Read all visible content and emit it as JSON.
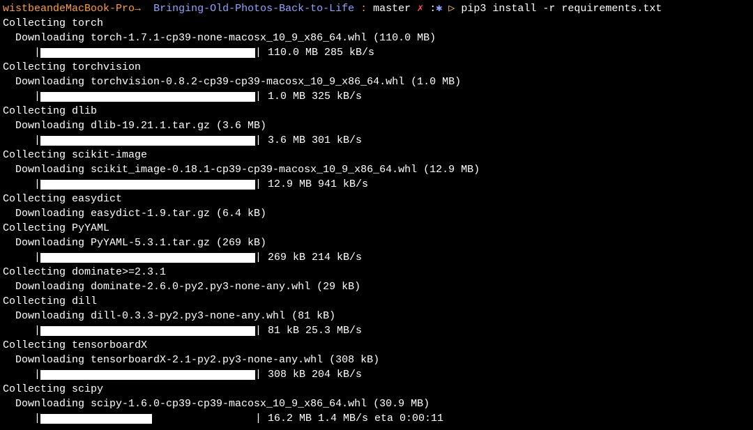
{
  "prompt": {
    "host": "wistbeandeMacBook-Pro",
    "arrow": "→",
    "directory": "Bringing-Old-Photos-Back-to-Life",
    "separator": ":",
    "branch": "master",
    "x": "✗",
    "colon": ":",
    "star": "✱",
    "triangle": "▷",
    "command": "pip3 install -r requirements.txt"
  },
  "packages": [
    {
      "collect": "Collecting torch",
      "download": "Downloading torch-1.7.1-cp39-none-macosx_10_9_x86_64.whl (110.0 MB)",
      "progress_pct": 100,
      "info": "| 110.0 MB 285 kB/s"
    },
    {
      "collect": "Collecting torchvision",
      "download": "Downloading torchvision-0.8.2-cp39-cp39-macosx_10_9_x86_64.whl (1.0 MB)",
      "progress_pct": 100,
      "info": "| 1.0 MB 325 kB/s"
    },
    {
      "collect": "Collecting dlib",
      "download": "Downloading dlib-19.21.1.tar.gz (3.6 MB)",
      "progress_pct": 100,
      "info": "| 3.6 MB 301 kB/s"
    },
    {
      "collect": "Collecting scikit-image",
      "download": "Downloading scikit_image-0.18.1-cp39-cp39-macosx_10_9_x86_64.whl (12.9 MB)",
      "progress_pct": 100,
      "info": "| 12.9 MB 941 kB/s"
    },
    {
      "collect": "Collecting easydict",
      "download": "Downloading easydict-1.9.tar.gz (6.4 kB)"
    },
    {
      "collect": "Collecting PyYAML",
      "download": "Downloading PyYAML-5.3.1.tar.gz (269 kB)",
      "progress_pct": 100,
      "info": "| 269 kB 214 kB/s"
    },
    {
      "collect": "Collecting dominate>=2.3.1",
      "download": "Downloading dominate-2.6.0-py2.py3-none-any.whl (29 kB)"
    },
    {
      "collect": "Collecting dill",
      "download": "Downloading dill-0.3.3-py2.py3-none-any.whl (81 kB)",
      "progress_pct": 100,
      "info": "| 81 kB 25.3 MB/s"
    },
    {
      "collect": "Collecting tensorboardX",
      "download": "Downloading tensorboardX-2.1-py2.py3-none-any.whl (308 kB)",
      "progress_pct": 100,
      "info": "| 308 kB 204 kB/s"
    },
    {
      "collect": "Collecting scipy",
      "download": "Downloading scipy-1.6.0-cp39-cp39-macosx_10_9_x86_64.whl (30.9 MB)",
      "progress_pct": 52,
      "info": "| 16.2 MB 1.4 MB/s eta 0:00:11"
    }
  ]
}
